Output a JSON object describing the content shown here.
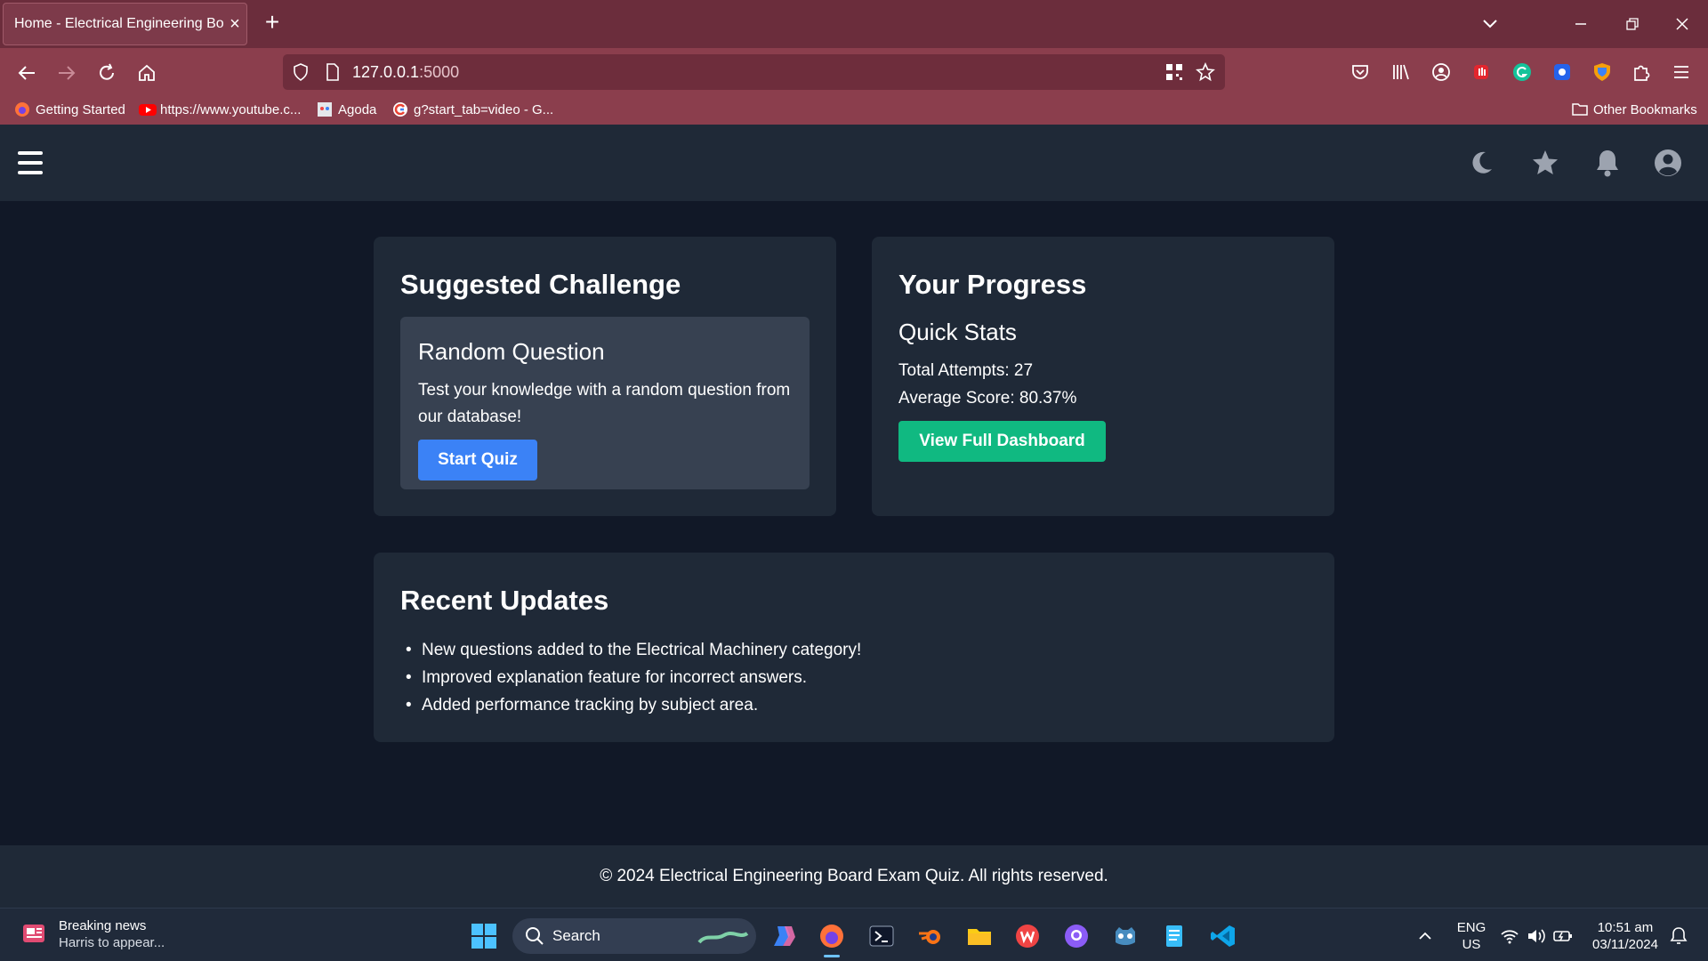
{
  "browser": {
    "tab_title": "Home - Electrical Engineering Boar",
    "url_host": "127.0.0.1",
    "url_port": ":5000",
    "bookmarks": [
      "Getting Started",
      "https://www.youtube.c...",
      "Agoda",
      "g?start_tab=video - G..."
    ],
    "other_bookmarks": "Other Bookmarks"
  },
  "colors": {
    "chrome": "#8b3e4d",
    "page_bg": "#111827",
    "card_bg": "#1f2937",
    "inner_card_bg": "#374151",
    "primary_button": "#3b82f6",
    "success_button": "#10b981"
  },
  "header_icons": [
    "menu-icon",
    "moon-icon",
    "star-icon",
    "bell-icon",
    "user-circle-icon"
  ],
  "suggested": {
    "title": "Suggested Challenge",
    "card_title": "Random Question",
    "card_desc": "Test your knowledge with a random question from our database!",
    "button": "Start Quiz"
  },
  "progress": {
    "title": "Your Progress",
    "subtitle": "Quick Stats",
    "total_attempts": "Total Attempts: 27",
    "average_score": "Average Score: 80.37%",
    "button": "View Full Dashboard"
  },
  "updates": {
    "title": "Recent Updates",
    "items": [
      "New questions added to the Electrical Machinery category!",
      "Improved explanation feature for incorrect answers.",
      "Added performance tracking by subject area."
    ]
  },
  "footer": "© 2024 Electrical Engineering Board Exam Quiz. All rights reserved.",
  "taskbar": {
    "news_title": "Breaking news",
    "news_sub": "Harris to appear...",
    "search_label": "Search",
    "lang_top": "ENG",
    "lang_bottom": "US",
    "time": "10:51 am",
    "date": "03/11/2024"
  }
}
